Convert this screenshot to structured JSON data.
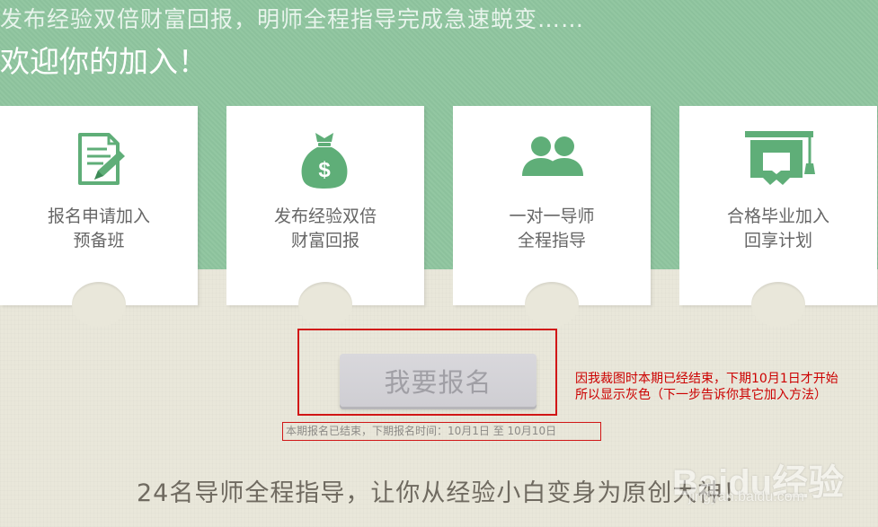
{
  "header": {
    "subtitle": "发布经验双倍财富回报，明师全程指导完成急速蜕变……",
    "title": "欢迎你的加入！"
  },
  "steps": [
    {
      "icon": "document-pen-icon",
      "line1": "报名申请加入",
      "line2": "预备班"
    },
    {
      "icon": "money-bag-icon",
      "line1": "发布经验双倍",
      "line2": "财富回报"
    },
    {
      "icon": "people-icon",
      "line1": "一对一导师",
      "line2": "全程指导"
    },
    {
      "icon": "graduation-cap-icon",
      "line1": "合格毕业加入",
      "line2": "回享计划"
    }
  ],
  "signup": {
    "button_label": "我要报名",
    "period_text": "本期报名已结束，下期报名时间：10月1日 至 10月10日"
  },
  "annotation": {
    "line1": "因我裁图时本期已经结束，下期10月1日才开始",
    "line2": "所以显示灰色（下一步告诉你其它加入方法）"
  },
  "slogan": "24名导师全程指导，让你从经验小白变身为原创大神！",
  "watermark": {
    "brand": "Baidu经验",
    "url": "jingyan.baidu.com"
  },
  "colors": {
    "band_green": "#8fc59f",
    "icon_green": "#5fae78",
    "annotation_red": "#cc0000",
    "button_gray": "#d5d4d9"
  }
}
